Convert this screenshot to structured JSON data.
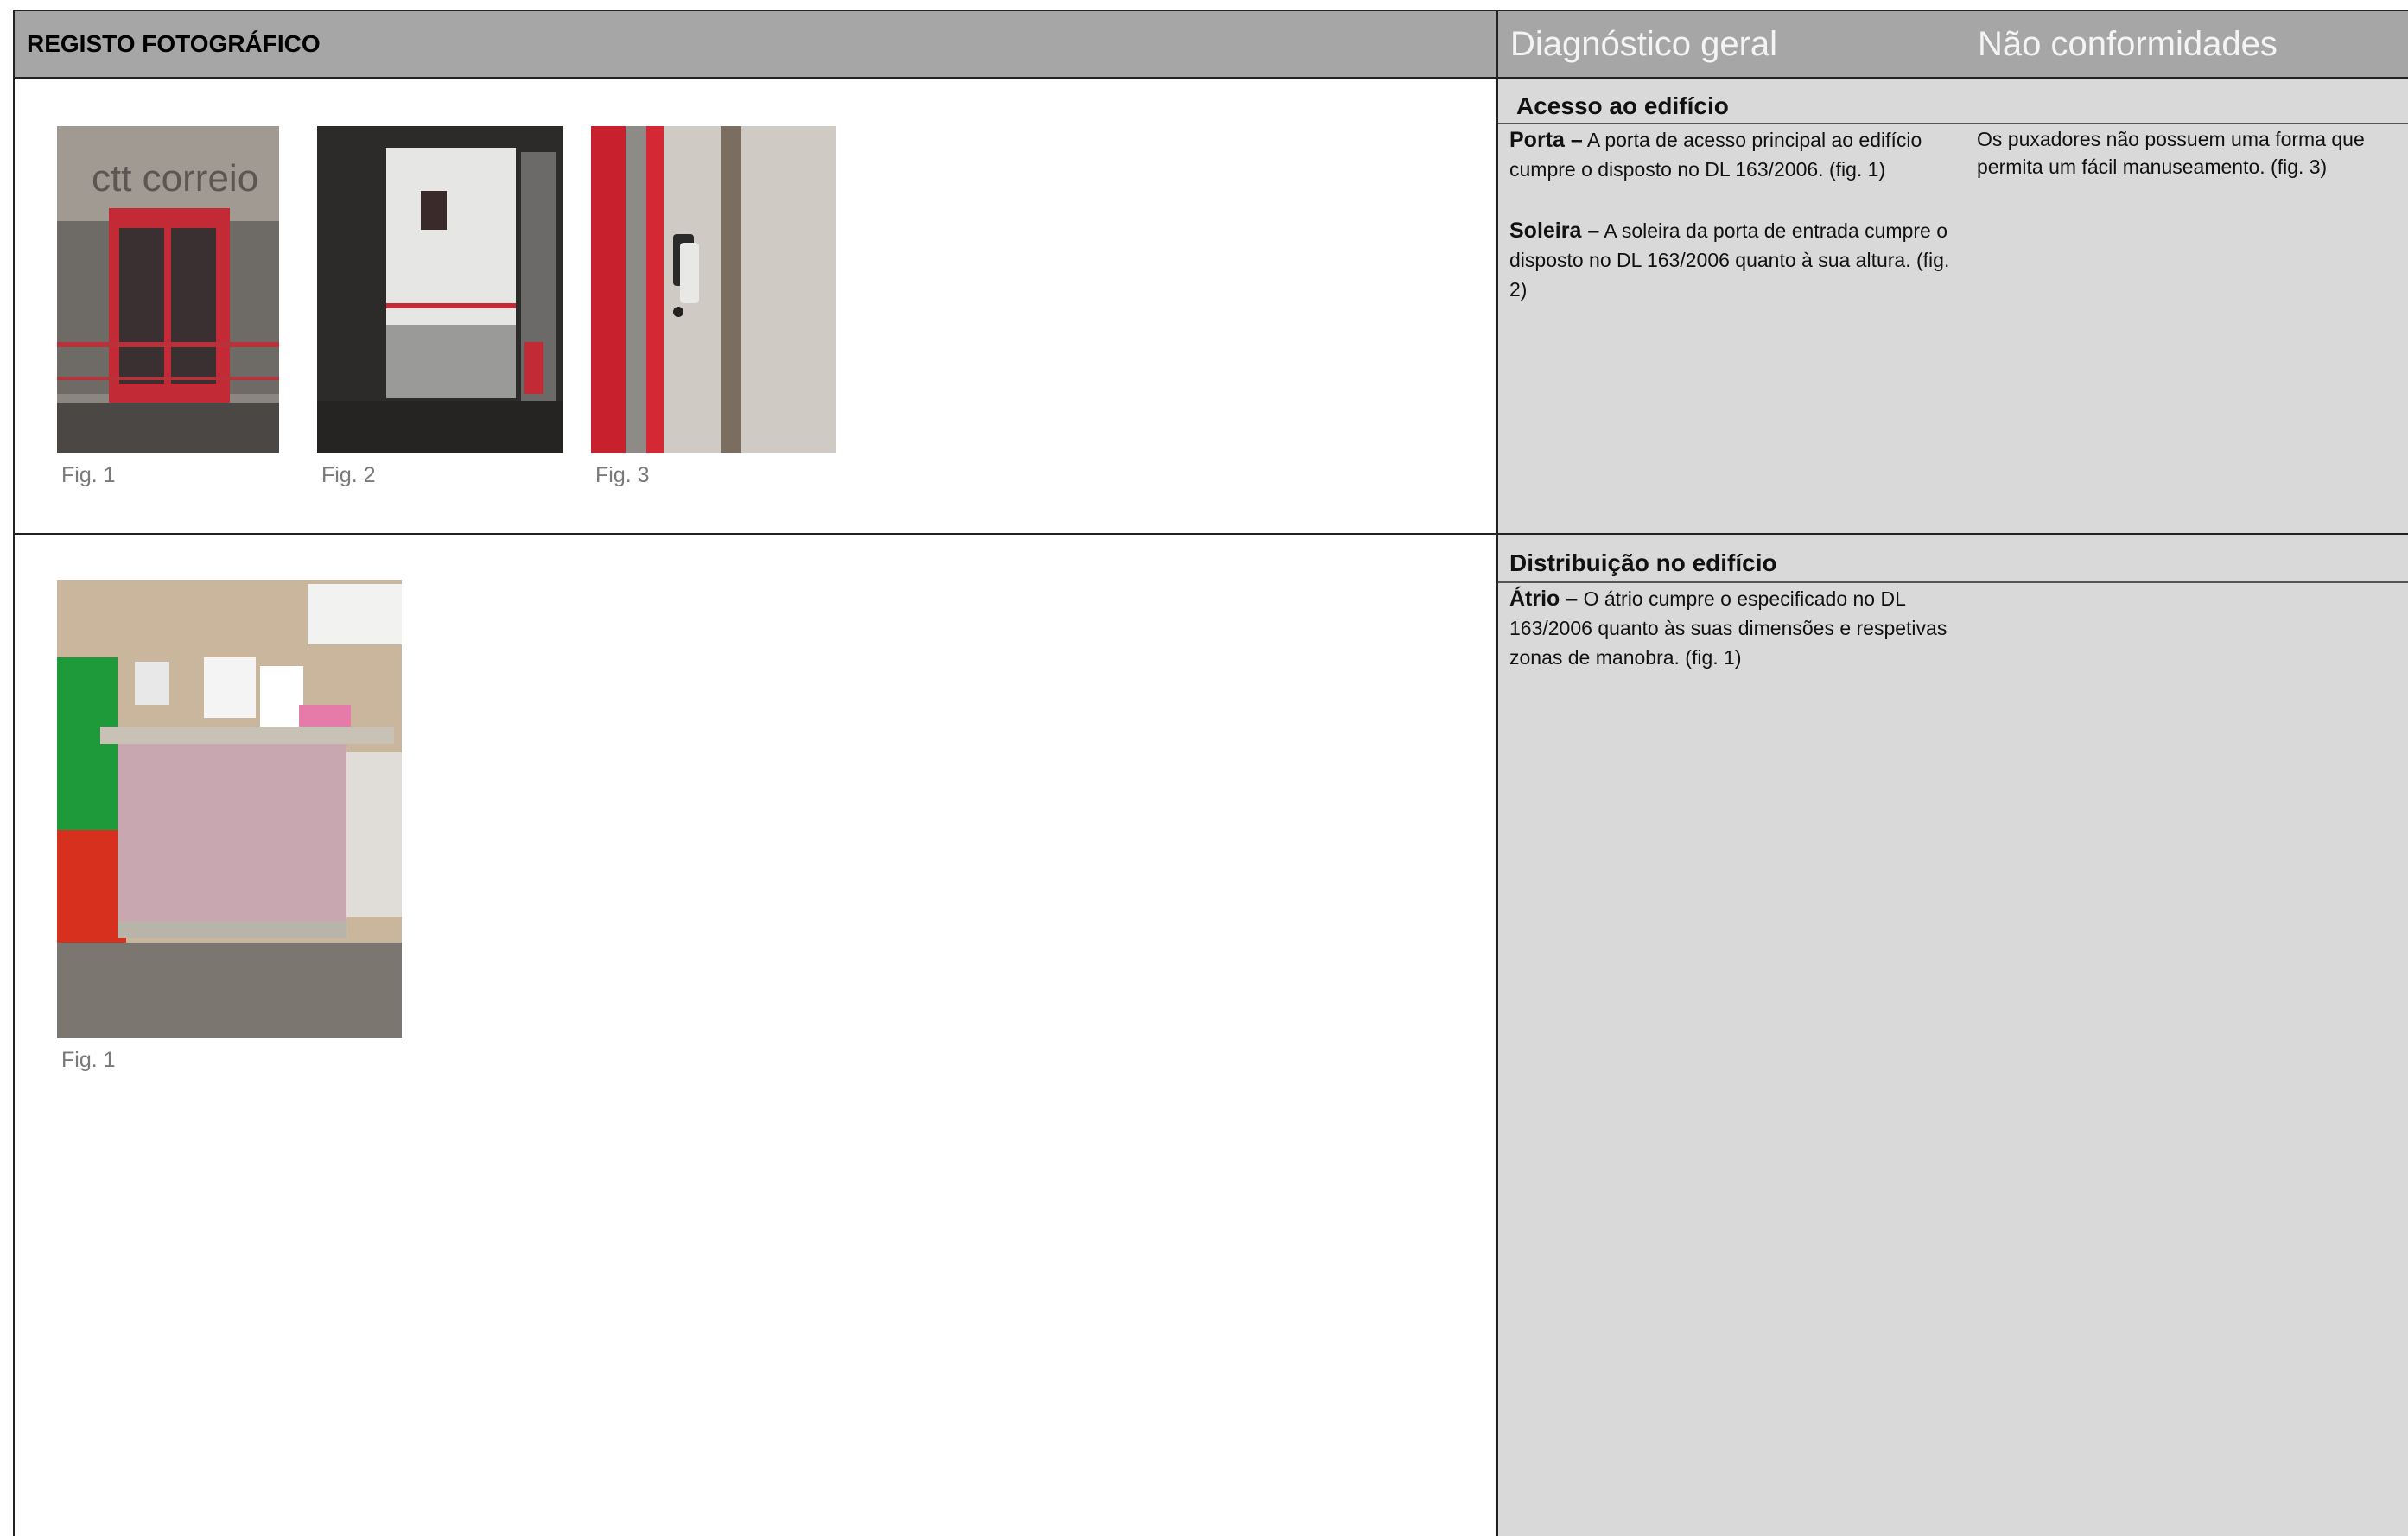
{
  "header": {
    "left_title": "REGISTO FOTOGRÁFICO",
    "col_diagnostico": "Diagnóstico geral",
    "col_nao_conformidades": "Não conformidades"
  },
  "section1": {
    "title": "Acesso ao edifício",
    "porta_label": "Porta –",
    "porta_text": " A porta de acesso principal ao edifício cumpre o disposto no DL 163/2006. (fig. 1)",
    "soleira_label": "Soleira –",
    "soleira_text": " A soleira da porta de entrada cumpre o disposto no DL 163/2006 quanto à sua altura. (fig. 2)",
    "nao_conformidade": "Os puxadores não possuem uma forma que permita um fácil manuseamento. (fig. 3)",
    "photo_sign_text": "ctt correio",
    "figures": [
      "Fig. 1",
      "Fig. 2",
      "Fig. 3"
    ]
  },
  "section2": {
    "title": "Distribuição no edifício",
    "atrio_label": "Átrio –",
    "atrio_text": " O átrio cumpre o especificado no DL 163/2006 quanto às suas dimensões e respetivas zonas de manobra. (fig. 1)",
    "figures": [
      "Fig. 1"
    ]
  },
  "colors": {
    "header_bg": "#a6a6a6",
    "panel_bg": "#d9d9d9",
    "ctt_red": "#d0202e"
  }
}
